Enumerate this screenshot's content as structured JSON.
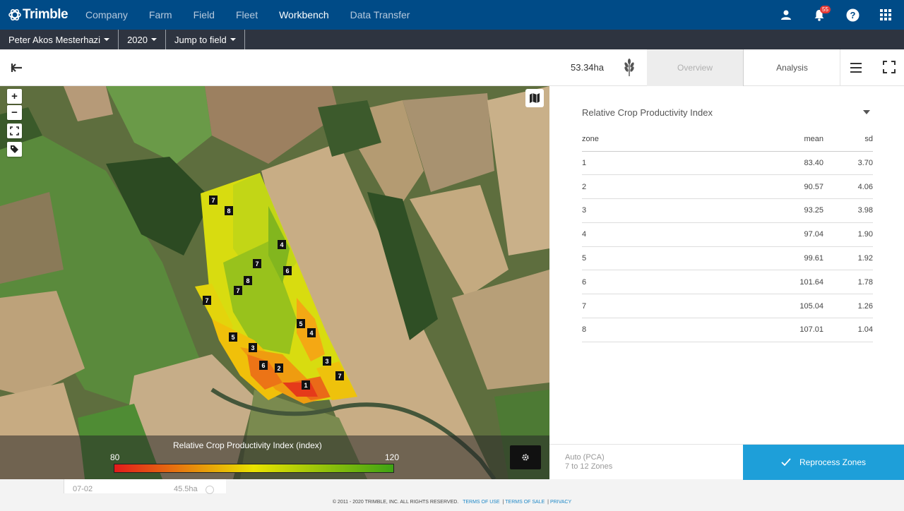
{
  "brand": {
    "logo_text": "Trimble",
    "nav_color": "#004b87",
    "accent": "#1e9fd9"
  },
  "nav": {
    "items": [
      {
        "label": "Company"
      },
      {
        "label": "Farm"
      },
      {
        "label": "Field"
      },
      {
        "label": "Fleet"
      },
      {
        "label": "Workbench",
        "active": true
      },
      {
        "label": "Data Transfer"
      }
    ],
    "notification_count": "55",
    "icons": [
      "user-icon",
      "bell-icon",
      "help-icon",
      "apps-grid-icon"
    ]
  },
  "subbar": {
    "user": "Peter Akos Mesterhazi",
    "year": "2020",
    "jump": "Jump to field"
  },
  "toolbar": {
    "area": "53.34ha",
    "tabs": [
      {
        "label": "Overview",
        "active": false
      },
      {
        "label": "Analysis",
        "active": true
      }
    ]
  },
  "map": {
    "legend": {
      "title": "Relative Crop Productivity Index (index)",
      "min": "80",
      "max": "120"
    },
    "zone_labels": [
      "7",
      "8",
      "4",
      "7",
      "6",
      "8",
      "7",
      "7",
      "5",
      "4",
      "5",
      "3",
      "6",
      "2",
      "3",
      "7",
      "1"
    ]
  },
  "panel": {
    "metric": "Relative Crop Productivity Index",
    "columns": {
      "zone": "zone",
      "mean": "mean",
      "sd": "sd"
    },
    "rows": [
      {
        "zone": "1",
        "mean": "83.40",
        "sd": "3.70"
      },
      {
        "zone": "2",
        "mean": "90.57",
        "sd": "4.06"
      },
      {
        "zone": "3",
        "mean": "93.25",
        "sd": "3.98"
      },
      {
        "zone": "4",
        "mean": "97.04",
        "sd": "1.90"
      },
      {
        "zone": "5",
        "mean": "99.61",
        "sd": "1.92"
      },
      {
        "zone": "6",
        "mean": "101.64",
        "sd": "1.78"
      },
      {
        "zone": "7",
        "mean": "105.04",
        "sd": "1.26"
      },
      {
        "zone": "8",
        "mean": "107.01",
        "sd": "1.04"
      }
    ],
    "auto_label": "Auto (PCA)",
    "zones_range": "7 to 12 Zones",
    "reprocess_label": "Reprocess Zones"
  },
  "bottom": {
    "date": "07-02",
    "area": "45.5ha"
  },
  "footer": {
    "copyright": "© 2011 - 2020 TRIMBLE, INC. ALL RIGHTS RESERVED.",
    "links": [
      "TERMS OF USE",
      "TERMS OF SALE",
      "PRIVACY"
    ]
  }
}
